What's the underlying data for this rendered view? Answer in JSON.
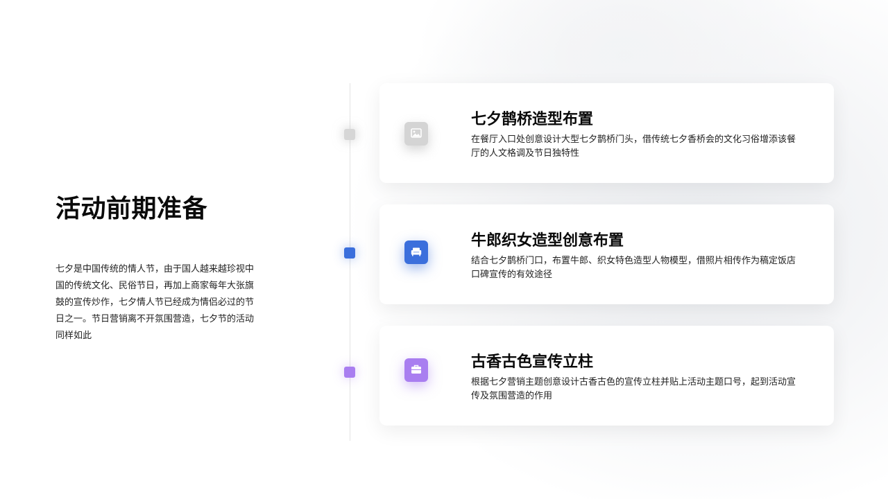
{
  "section": {
    "title": "活动前期准备",
    "intro": "七夕是中国传统的情人节，由于国人越来越珍视中国的传统文化、民俗节日，再加上商家每年大张旗鼓的宣传炒作，七夕情人节已经成为情侣必过的节日之一。节日营销离不开氛围营造，七夕节的活动同样如此"
  },
  "colors": {
    "item1_accent": "#d4d4d4",
    "item2_accent": "#3b6fdc",
    "item3_accent": "#a97ef0"
  },
  "items": [
    {
      "icon": "image-icon",
      "title": "七夕鹊桥造型布置",
      "description": "在餐厅入口处创意设计大型七夕鹊桥门头，借传统七夕香桥会的文化习俗增添该餐厅的人文格调及节日独特性"
    },
    {
      "icon": "sofa-icon",
      "title": "牛郎织女造型创意布置",
      "description": "结合七夕鹊桥门口，布置牛郎、织女特色造型人物模型，借照片相传作为稿定饭店口碑宣传的有效途径"
    },
    {
      "icon": "briefcase-icon",
      "title": "古香古色宣传立柱",
      "description": "根据七夕营销主题创意设计古香古色的宣传立柱并贴上活动主题口号，起到活动宣传及氛围营造的作用"
    }
  ]
}
